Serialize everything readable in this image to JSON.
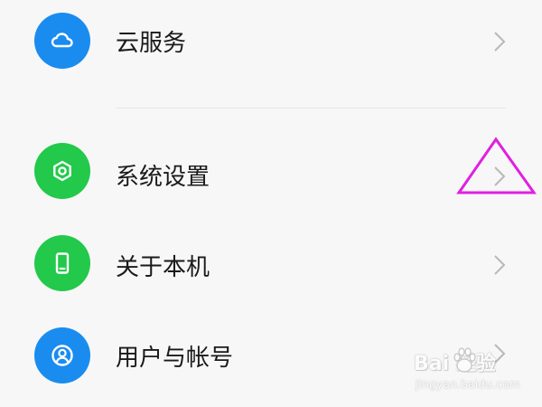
{
  "settings": {
    "items": [
      {
        "label": "云服务",
        "icon": "cloud-icon",
        "color": "#1a8cf0"
      },
      {
        "label": "系统设置",
        "icon": "hexagon-settings-icon",
        "color": "#22c94a"
      },
      {
        "label": "关于本机",
        "icon": "phone-icon",
        "color": "#22c94a"
      },
      {
        "label": "用户与帐号",
        "icon": "user-circle-icon",
        "color": "#1a8cf0"
      }
    ],
    "chevron_icon": "chevron-right-icon"
  },
  "annotation": {
    "shape": "triangle",
    "color": "#e020e0"
  },
  "watermark": {
    "logo_text": "Bai  经验",
    "url": "jingyan.baidu.com"
  }
}
